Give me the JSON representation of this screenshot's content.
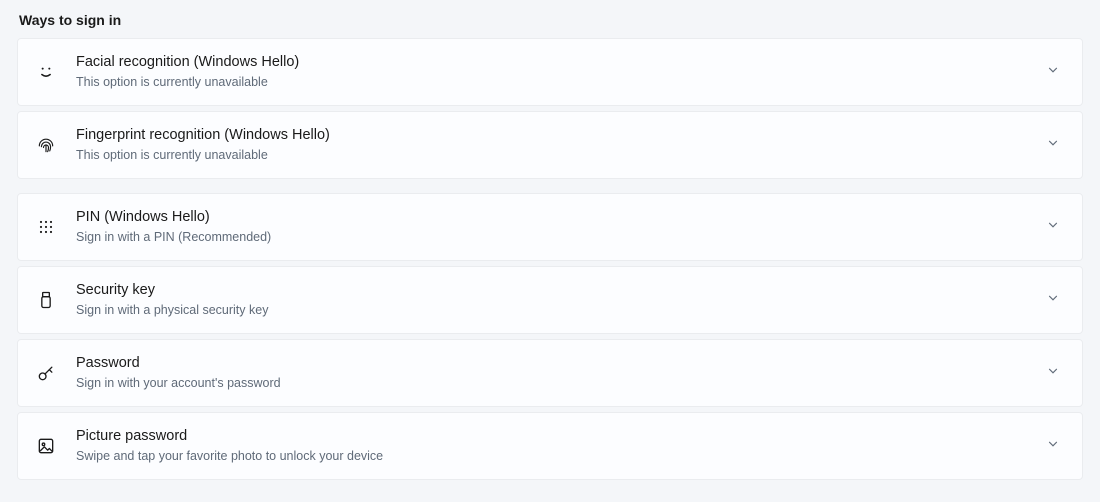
{
  "section_title": "Ways to sign in",
  "options": [
    {
      "title": "Facial recognition (Windows Hello)",
      "subtitle": "This option is currently unavailable"
    },
    {
      "title": "Fingerprint recognition (Windows Hello)",
      "subtitle": "This option is currently unavailable"
    },
    {
      "title": "PIN (Windows Hello)",
      "subtitle": "Sign in with a PIN (Recommended)"
    },
    {
      "title": "Security key",
      "subtitle": "Sign in with a physical security key"
    },
    {
      "title": "Password",
      "subtitle": "Sign in with your account's password"
    },
    {
      "title": "Picture password",
      "subtitle": "Swipe and tap your favorite photo to unlock your device"
    }
  ]
}
